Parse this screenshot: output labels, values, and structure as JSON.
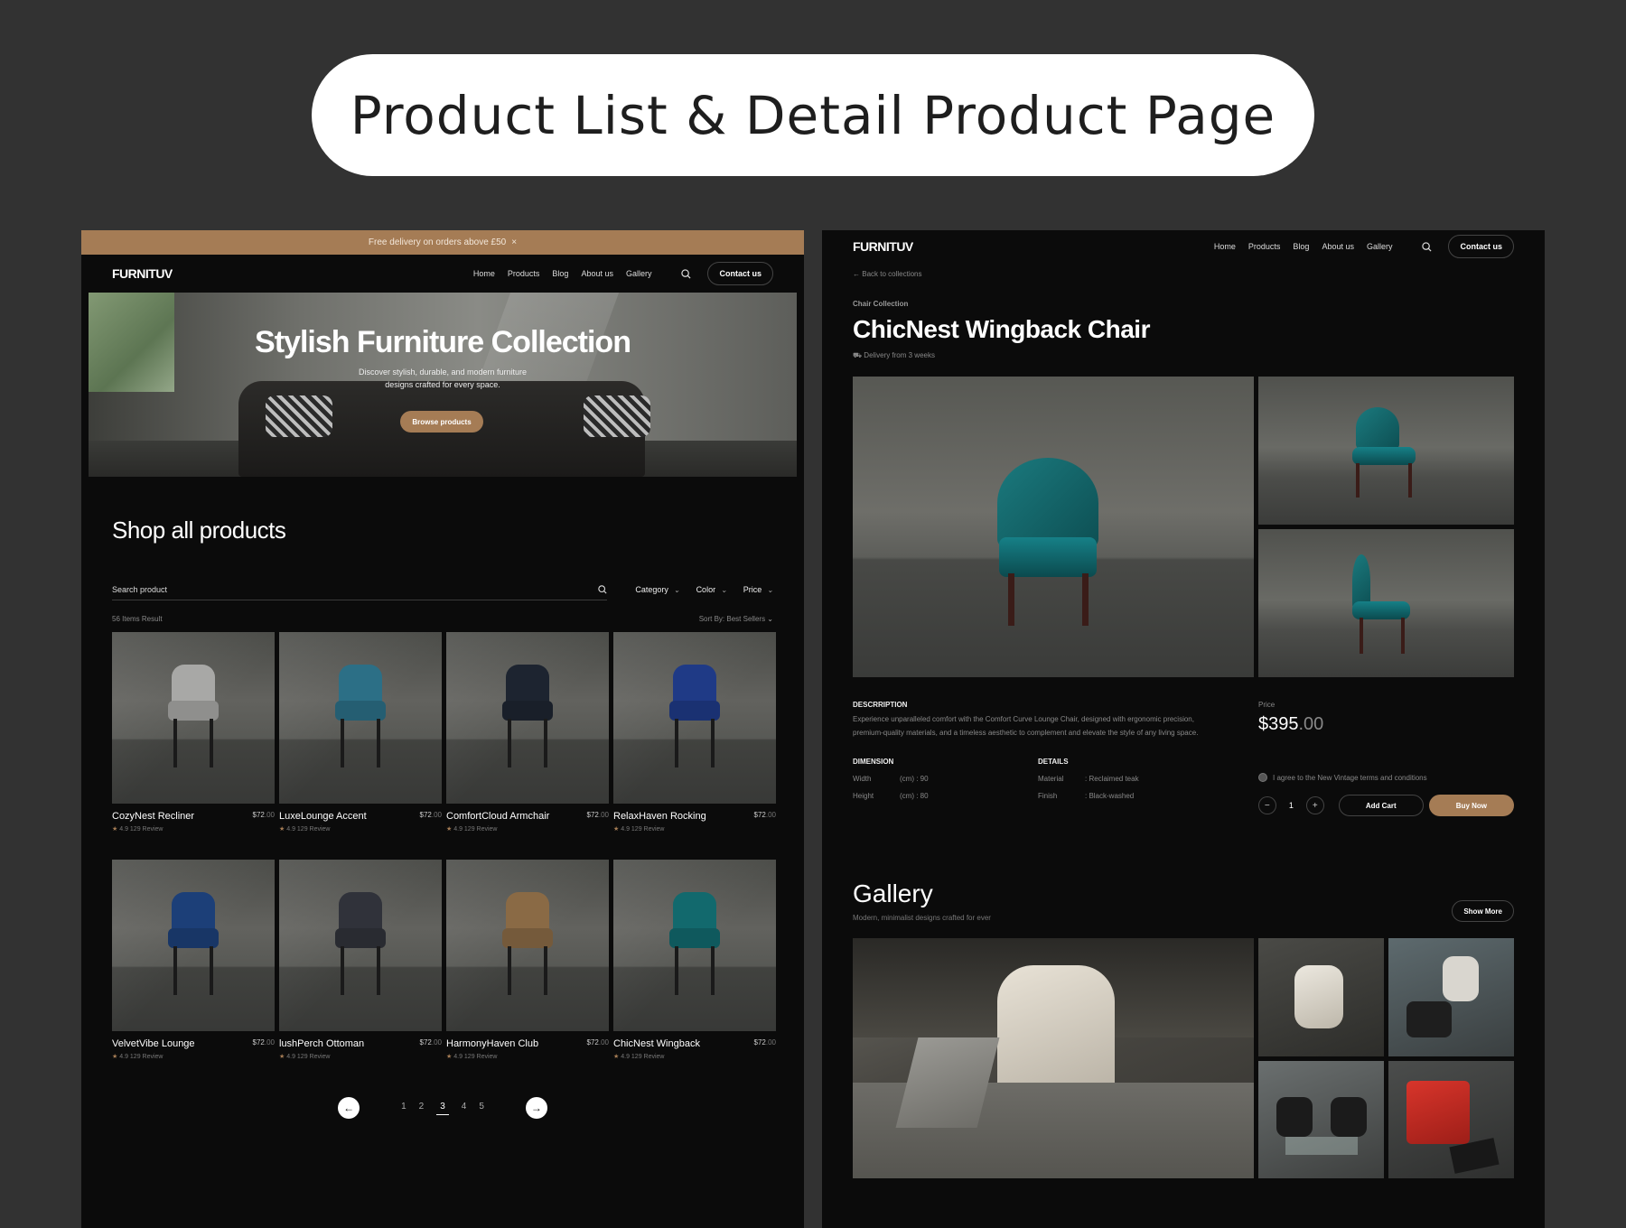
{
  "page_title": "Product List & Detail Product Page",
  "list_page": {
    "promo": {
      "text": "Free delivery on orders above £50",
      "close": "×"
    },
    "nav": {
      "logo": "FURNITUV",
      "links": [
        "Home",
        "Products",
        "Blog",
        "About us",
        "Gallery"
      ],
      "contact": "Contact us"
    },
    "hero": {
      "title": "Stylish Furniture Collection",
      "subtitle_line1": "Discover stylish, durable, and modern furniture",
      "subtitle_line2": "designs crafted for every space.",
      "cta": "Browse products"
    },
    "shop_title": "Shop all products",
    "search_placeholder": "Search product",
    "filters": [
      "Category",
      "Color",
      "Price"
    ],
    "result_count": "56 Items Result",
    "sort": "Sort By: Best Sellers",
    "products": [
      {
        "name": "CozyNest Recliner",
        "price_main": "$72",
        "price_cents": ".00",
        "rating": "4.9 129 Review",
        "color": "#a8a8a6"
      },
      {
        "name": "LuxeLounge Accent",
        "price_main": "$72",
        "price_cents": ".00",
        "rating": "4.9 129 Review",
        "color": "#2c6f86"
      },
      {
        "name": "ComfortCloud Armchair",
        "price_main": "$72",
        "price_cents": ".00",
        "rating": "4.9 129 Review",
        "color": "#1d2430"
      },
      {
        "name": "RelaxHaven Rocking",
        "price_main": "$72",
        "price_cents": ".00",
        "rating": "4.9 129 Review",
        "color": "#1f3a86"
      },
      {
        "name": "VelvetVibe Lounge",
        "price_main": "$72",
        "price_cents": ".00",
        "rating": "4.9 129 Review",
        "color": "#1c3f78"
      },
      {
        "name": "lushPerch Ottoman",
        "price_main": "$72",
        "price_cents": ".00",
        "rating": "4.9 129 Review",
        "color": "#30323a"
      },
      {
        "name": "HarmonyHaven Club",
        "price_main": "$72",
        "price_cents": ".00",
        "rating": "4.9 129 Review",
        "color": "#8a6a45"
      },
      {
        "name": "ChicNest Wingback",
        "price_main": "$72",
        "price_cents": ".00",
        "rating": "4.9 129 Review",
        "color": "#12696d"
      }
    ],
    "pagination": {
      "prev": "←",
      "next": "→",
      "pages": [
        "1",
        "2",
        "3",
        "4",
        "5"
      ],
      "current": "3"
    }
  },
  "detail_page": {
    "nav": {
      "logo": "FURNITUV",
      "links": [
        "Home",
        "Products",
        "Blog",
        "About us",
        "Gallery"
      ],
      "contact": "Contact us"
    },
    "back": "Back to collections",
    "category": "Chair Collection",
    "title": "ChicNest Wingback Chair",
    "delivery": "Delivery from 3 weeks",
    "description_label": "DESCRRIPTION",
    "description": "Experience unparalleled comfort with the Comfort Curve Lounge Chair, designed with ergonomic precision, premium-quality materials, and a timeless aesthetic to complement and elevate the style of any living space.",
    "dimension_label": "DIMENSION",
    "dimension": [
      {
        "key": "Width",
        "value": "(cm) : 90"
      },
      {
        "key": "Height",
        "value": "(cm) : 80"
      }
    ],
    "details_label": "DETAILS",
    "details": [
      {
        "key": "Material",
        "value": ": Reclaimed teak"
      },
      {
        "key": "Finish",
        "value": ": Black-washed"
      }
    ],
    "price_label": "Price",
    "price_main": "$395",
    "price_cents": ".00",
    "agree": "I agree to the New Vintage terms and conditions",
    "qty": {
      "minus": "−",
      "value": "1",
      "plus": "+"
    },
    "add_cart": "Add Cart",
    "buy_now": "Buy Now",
    "gallery": {
      "title": "Gallery",
      "subtitle": "Modern, minimalist designs crafted for ever",
      "show_more": "Show More"
    }
  },
  "colors": {
    "accent": "#a57c55",
    "panel": "#0b0b0b",
    "backdrop": "#323232"
  }
}
